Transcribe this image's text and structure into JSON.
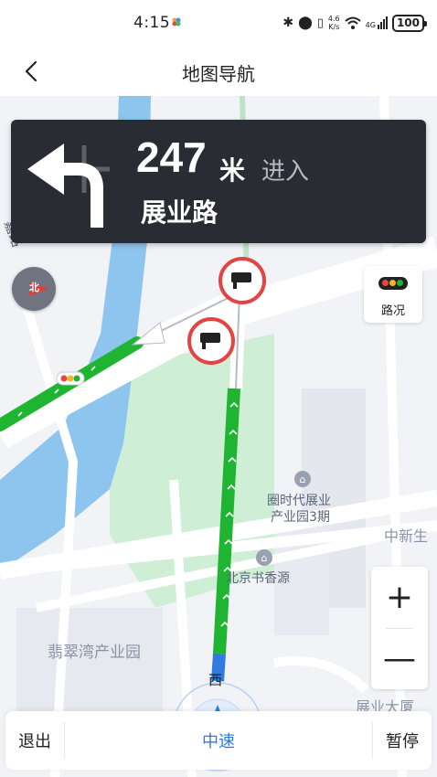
{
  "status_bar": {
    "time": "4:15",
    "network_speed_value": "4.6",
    "network_speed_unit": "K/s",
    "network_type": "4G",
    "battery": "100"
  },
  "header": {
    "title": "地图导航"
  },
  "guidance": {
    "distance": "247",
    "unit": "米",
    "action": "进入",
    "road": "展业路"
  },
  "map": {
    "compass_label": "北",
    "traffic_label": "路况",
    "labels": {
      "road_left": "嘉路",
      "poi_park_1": "圈时代展业",
      "poi_park_2": "产业园3期",
      "poi_bookstore": "北京书香源",
      "area_zhongxin": "中新生",
      "area_feicui": "翡翠湾产业园",
      "area_zhanye": "展业大厦",
      "road_west": "西"
    },
    "colors": {
      "route_green": "#1fb532",
      "route_blue": "#2f7be0",
      "water": "#8ec5ef",
      "park": "#cfeed6"
    }
  },
  "zoom": {
    "in_label": "+",
    "out_label": "—"
  },
  "bottom_bar": {
    "exit_label": "退出",
    "speed_label": "中速",
    "pause_label": "暂停"
  }
}
